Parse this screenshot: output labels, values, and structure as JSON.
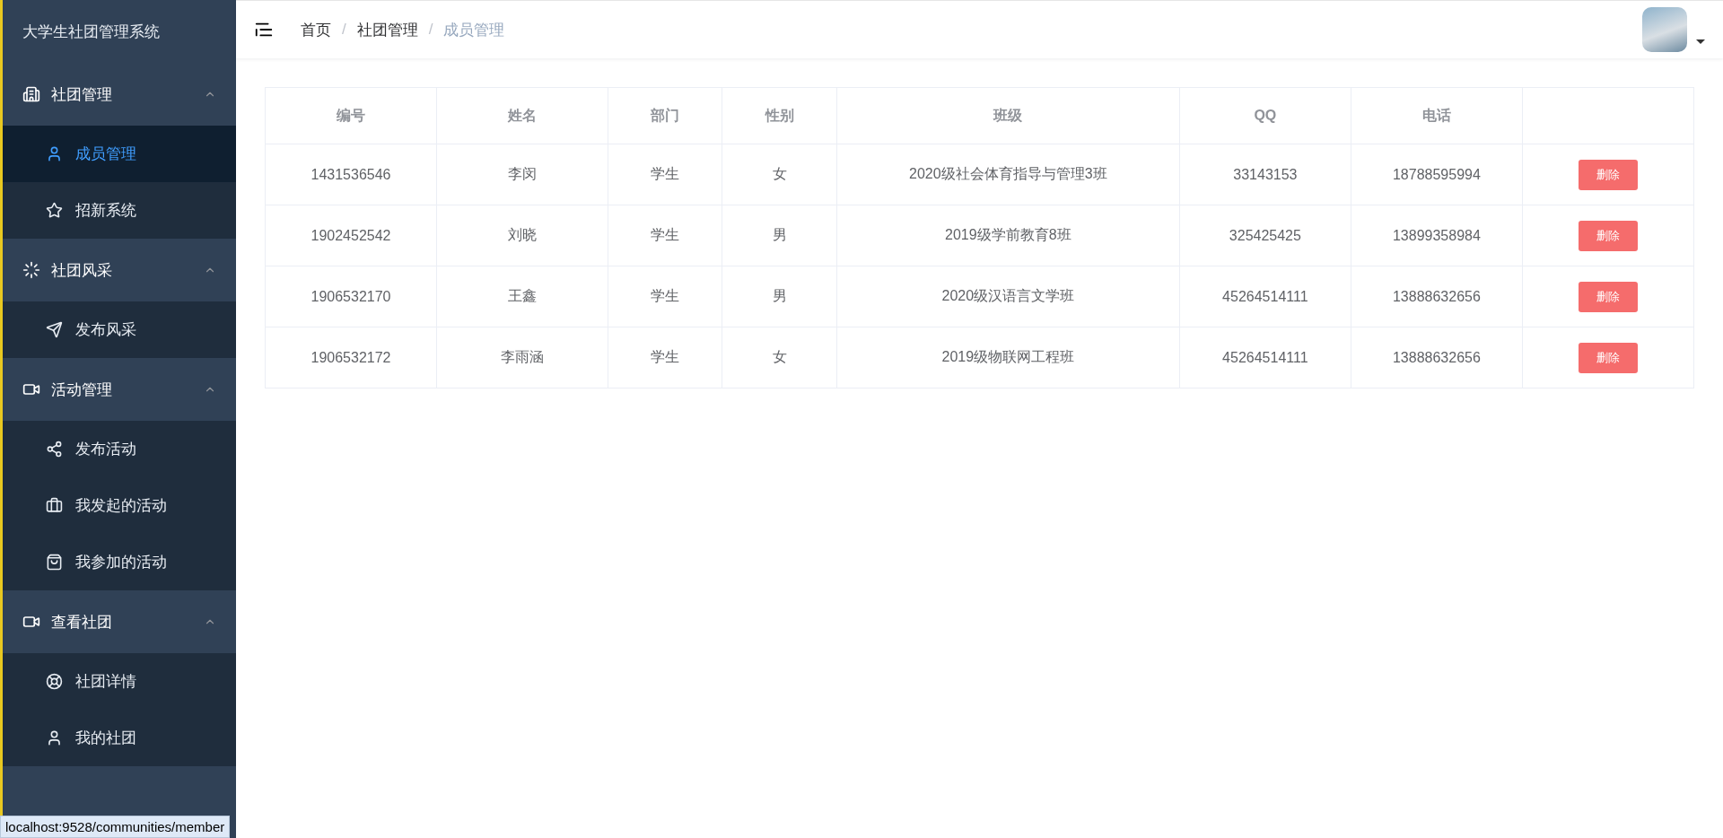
{
  "sidebar": {
    "title": "大学生社团管理系统",
    "groups": [
      {
        "label": "社团管理",
        "expanded": true,
        "children": [
          {
            "label": "成员管理",
            "selected": true
          },
          {
            "label": "招新系统",
            "selected": false
          }
        ]
      },
      {
        "label": "社团风采",
        "expanded": true,
        "children": [
          {
            "label": "发布风采",
            "selected": false
          }
        ]
      },
      {
        "label": "活动管理",
        "expanded": true,
        "children": [
          {
            "label": "发布活动",
            "selected": false
          },
          {
            "label": "我发起的活动",
            "selected": false
          },
          {
            "label": "我参加的活动",
            "selected": false
          }
        ]
      },
      {
        "label": "查看社团",
        "expanded": true,
        "children": [
          {
            "label": "社团详情",
            "selected": false
          },
          {
            "label": "我的社团",
            "selected": false
          }
        ]
      }
    ]
  },
  "breadcrumb": {
    "items": [
      "首页",
      "社团管理",
      "成员管理"
    ],
    "separators": [
      "/",
      "/"
    ]
  },
  "table": {
    "columns": [
      "编号",
      "姓名",
      "部门",
      "性别",
      "班级",
      "QQ",
      "电话"
    ],
    "rows": [
      {
        "cells": [
          "1431536546",
          "李闵",
          "学生",
          "女",
          "2020级社会体育指导与管理3班",
          "33143153",
          "18788595994"
        ],
        "action": "删除"
      },
      {
        "cells": [
          "1902452542",
          "刘晓",
          "学生",
          "男",
          "2019级学前教育8班",
          "325425425",
          "13899358984"
        ],
        "action": "删除"
      },
      {
        "cells": [
          "1906532170",
          "王鑫",
          "学生",
          "男",
          "2020级汉语言文学班",
          "45264514111",
          "13888632656"
        ],
        "action": "删除"
      },
      {
        "cells": [
          "1906532172",
          "李雨涵",
          "学生",
          "女",
          "2019级物联网工程班",
          "45264514111",
          "13888632656"
        ],
        "action": "删除"
      }
    ]
  },
  "status_bar": "localhost:9528/communities/member"
}
